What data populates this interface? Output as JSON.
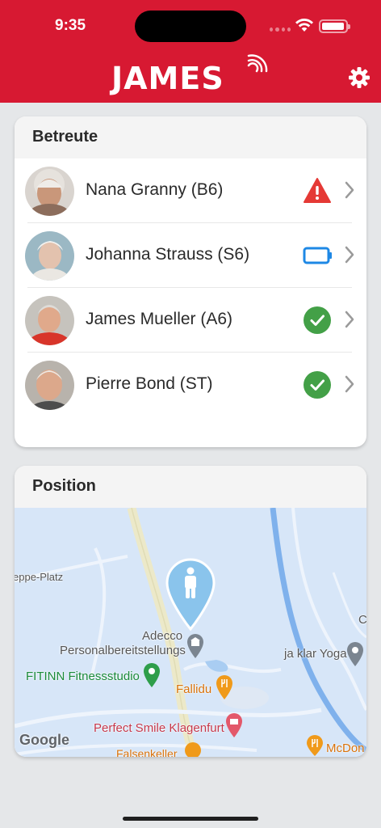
{
  "status_bar": {
    "time": "9:35"
  },
  "header": {
    "logo": "JAMES"
  },
  "people_card": {
    "title": "Betreute",
    "people": [
      {
        "name": "Nana Granny (B6)",
        "status": "warning-icon",
        "status_color": "#e53935"
      },
      {
        "name": "Johanna Strauss (S6)",
        "status": "battery-low-icon",
        "status_color": "#1e88e5"
      },
      {
        "name": "James Mueller (A6)",
        "status": "check-circle-icon",
        "status_color": "#43a047"
      },
      {
        "name": "Pierre Bond (ST)",
        "status": "check-circle-icon",
        "status_color": "#43a047"
      }
    ]
  },
  "position_card": {
    "title": "Position",
    "map": {
      "labels": {
        "street": "eppe-Platz",
        "adecco_1": "Adecco",
        "adecco_2": "Personalbereitstellungs",
        "yoga": "ja klar Yoga",
        "fitinn": "FITINN Fitnessstudio",
        "fallidu": "Fallidu",
        "smile": "Perfect Smile Klagenfurt",
        "falsen": "Falsenkeller",
        "mcdon": "McDon",
        "edge": "C",
        "attribution": "Google"
      }
    }
  },
  "colors": {
    "brand": "#d71932",
    "ok": "#43a047",
    "warning": "#e53935",
    "battery": "#1e88e5",
    "pin": "#8ac4ec"
  }
}
